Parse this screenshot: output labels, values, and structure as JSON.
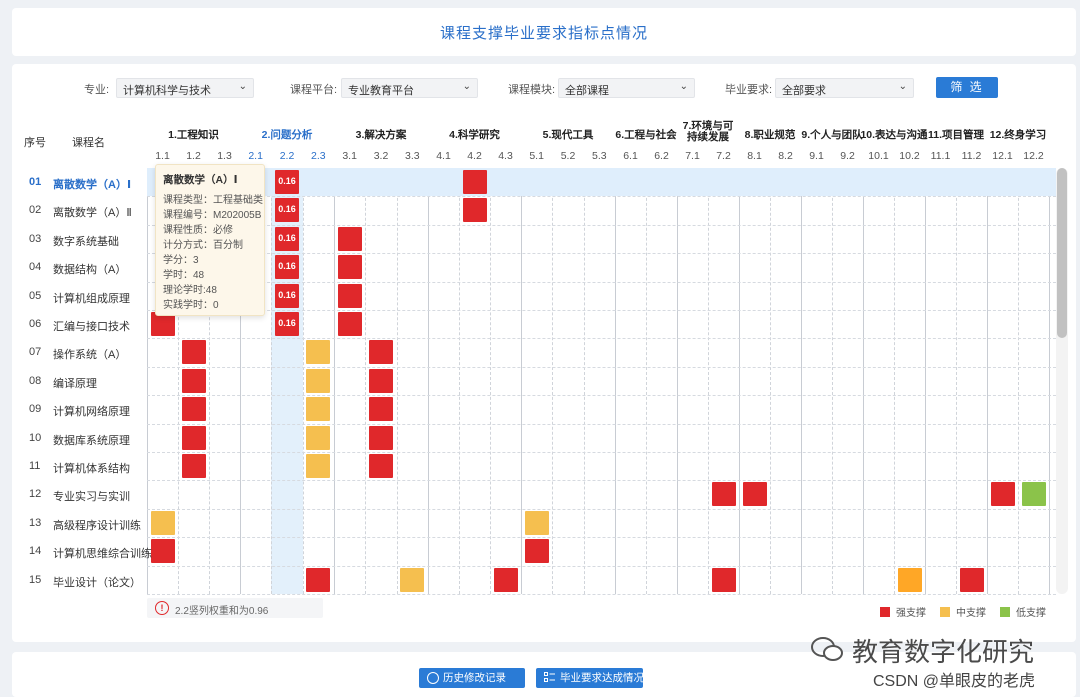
{
  "page_title": "课程支撑毕业要求指标点情况",
  "filters": [
    {
      "label": "专业:",
      "value": "计算机科学与技术"
    },
    {
      "label": "课程平台:",
      "value": "专业教育平台"
    },
    {
      "label": "课程模块:",
      "value": "全部课程"
    },
    {
      "label": "毕业要求:",
      "value": "全部要求"
    }
  ],
  "filter_button": "筛 选",
  "table_headers": {
    "index": "序号",
    "course": "课程名"
  },
  "requirement_groups": [
    "1.工程知识",
    "2.问题分析",
    "3.解决方案",
    "4.科学研究",
    "5.现代工具",
    "6.工程与社会",
    "7.环境与可持续发展",
    "8.职业规范",
    "9.个人与团队",
    "10.表达与沟通",
    "11.项目管理",
    "12.终身学习"
  ],
  "group7_lines": [
    "7.环境与可",
    "持续发展"
  ],
  "indicators": [
    "1.1",
    "1.2",
    "1.3",
    "2.1",
    "2.2",
    "2.3",
    "3.1",
    "3.2",
    "3.3",
    "4.1",
    "4.2",
    "4.3",
    "5.1",
    "5.2",
    "5.3",
    "6.1",
    "6.2",
    "7.1",
    "7.2",
    "8.1",
    "8.2",
    "9.1",
    "9.2",
    "10.1",
    "10.2",
    "11.1",
    "11.2",
    "12.1",
    "12.2"
  ],
  "courses": [
    {
      "no": "01",
      "name": "离散数学（A）Ⅰ"
    },
    {
      "no": "02",
      "name": "离散数学（A）Ⅱ"
    },
    {
      "no": "03",
      "name": "数字系统基础"
    },
    {
      "no": "04",
      "name": "数据结构（A）"
    },
    {
      "no": "05",
      "name": "计算机组成原理"
    },
    {
      "no": "06",
      "name": "汇编与接口技术"
    },
    {
      "no": "07",
      "name": "操作系统（A）"
    },
    {
      "no": "08",
      "name": "编译原理"
    },
    {
      "no": "09",
      "name": "计算机网络原理"
    },
    {
      "no": "10",
      "name": "数据库系统原理"
    },
    {
      "no": "11",
      "name": "计算机体系结构"
    },
    {
      "no": "12",
      "name": "专业实习与实训"
    },
    {
      "no": "13",
      "name": "高级程序设计训练"
    },
    {
      "no": "14",
      "name": "计算机思维综合训练"
    },
    {
      "no": "15",
      "name": "毕业设计（论文）"
    }
  ],
  "support_cells": [
    {
      "row": 0,
      "col": 4,
      "level": "strong",
      "value": "0.16"
    },
    {
      "row": 0,
      "col": 10,
      "level": "strong"
    },
    {
      "row": 1,
      "col": 4,
      "level": "strong",
      "value": "0.16"
    },
    {
      "row": 1,
      "col": 10,
      "level": "strong"
    },
    {
      "row": 2,
      "col": 4,
      "level": "strong",
      "value": "0.16"
    },
    {
      "row": 2,
      "col": 6,
      "level": "strong"
    },
    {
      "row": 3,
      "col": 4,
      "level": "strong",
      "value": "0.16"
    },
    {
      "row": 3,
      "col": 6,
      "level": "strong"
    },
    {
      "row": 4,
      "col": 4,
      "level": "strong",
      "value": "0.16"
    },
    {
      "row": 4,
      "col": 6,
      "level": "strong"
    },
    {
      "row": 5,
      "col": 0,
      "level": "strong"
    },
    {
      "row": 5,
      "col": 4,
      "level": "strong",
      "value": "0.16"
    },
    {
      "row": 5,
      "col": 6,
      "level": "strong"
    },
    {
      "row": 6,
      "col": 1,
      "level": "strong"
    },
    {
      "row": 6,
      "col": 5,
      "level": "medium"
    },
    {
      "row": 6,
      "col": 7,
      "level": "strong"
    },
    {
      "row": 7,
      "col": 1,
      "level": "strong"
    },
    {
      "row": 7,
      "col": 5,
      "level": "medium"
    },
    {
      "row": 7,
      "col": 7,
      "level": "strong"
    },
    {
      "row": 8,
      "col": 1,
      "level": "strong"
    },
    {
      "row": 8,
      "col": 5,
      "level": "medium"
    },
    {
      "row": 8,
      "col": 7,
      "level": "strong"
    },
    {
      "row": 9,
      "col": 1,
      "level": "strong"
    },
    {
      "row": 9,
      "col": 5,
      "level": "medium"
    },
    {
      "row": 9,
      "col": 7,
      "level": "strong"
    },
    {
      "row": 10,
      "col": 1,
      "level": "strong"
    },
    {
      "row": 10,
      "col": 5,
      "level": "medium"
    },
    {
      "row": 10,
      "col": 7,
      "level": "strong"
    },
    {
      "row": 11,
      "col": 18,
      "level": "strong"
    },
    {
      "row": 11,
      "col": 19,
      "level": "strong"
    },
    {
      "row": 11,
      "col": 27,
      "level": "strong"
    },
    {
      "row": 11,
      "col": 28,
      "level": "weak"
    },
    {
      "row": 12,
      "col": 0,
      "level": "medium"
    },
    {
      "row": 12,
      "col": 12,
      "level": "medium"
    },
    {
      "row": 13,
      "col": 0,
      "level": "strong"
    },
    {
      "row": 13,
      "col": 12,
      "level": "strong"
    },
    {
      "row": 14,
      "col": 5,
      "level": "strong"
    },
    {
      "row": 14,
      "col": 8,
      "level": "medium"
    },
    {
      "row": 14,
      "col": 11,
      "level": "strong"
    },
    {
      "row": 14,
      "col": 18,
      "level": "strong"
    },
    {
      "row": 14,
      "col": 24,
      "level": "medium-orange"
    },
    {
      "row": 14,
      "col": 26,
      "level": "strong"
    }
  ],
  "colors": {
    "strong": "#e0282b",
    "medium": "#f5bf4f",
    "medium-orange": "#ffa726",
    "weak": "#8bc34a",
    "accent": "#2a6fc9"
  },
  "tooltip": {
    "title": "离散数学（A）Ⅰ",
    "lines": [
      "课程类型：工程基础类",
      "课程编号：M202005B",
      "课程性质：必修",
      "计分方式：百分制",
      "学分：3",
      "学时：48",
      "理论学时:48",
      "实践学时：0"
    ]
  },
  "warning": "2.2竖列权重和为0.96",
  "legend": {
    "strong": "强支撑",
    "medium": "中支撑",
    "weak": "低支撑"
  },
  "buttons": {
    "history": "历史修改记录",
    "achievement": "毕业要求达成情况"
  },
  "watermark": {
    "main": "教育数字化研究",
    "sub": "CSDN @单眼皮的老虎"
  }
}
